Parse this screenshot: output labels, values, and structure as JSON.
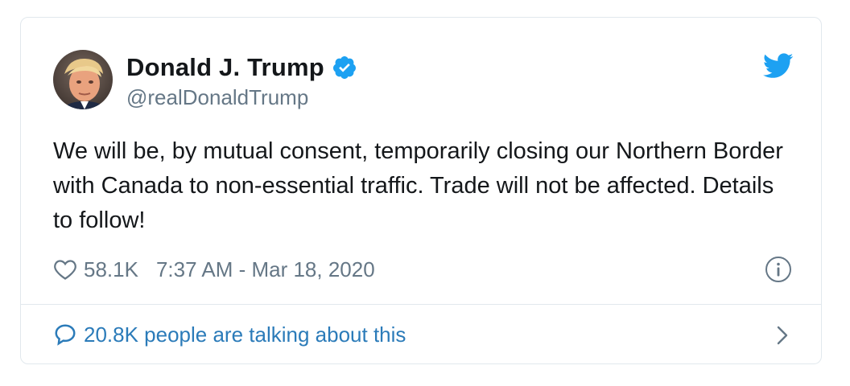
{
  "tweet": {
    "author": {
      "display_name": "Donald J. Trump",
      "handle": "@realDonaldTrump",
      "verified": true,
      "avatar_icon": "avatar-photo"
    },
    "brand_icon": "twitter-bird-icon",
    "text": "We will be, by mutual consent, temporarily closing our Northern Border with Canada to non-essential traffic. Trade will not be affected. Details to follow!",
    "likes": "58.1K",
    "timestamp": "7:37 AM - Mar 18, 2020",
    "footer_text": "20.8K people are talking about this"
  },
  "colors": {
    "verified": "#1da1f2",
    "twitter_blue": "#1da1f2",
    "link": "#2b7bb9",
    "muted": "#657786",
    "text": "#14171a",
    "border": "#e1e8ed"
  }
}
